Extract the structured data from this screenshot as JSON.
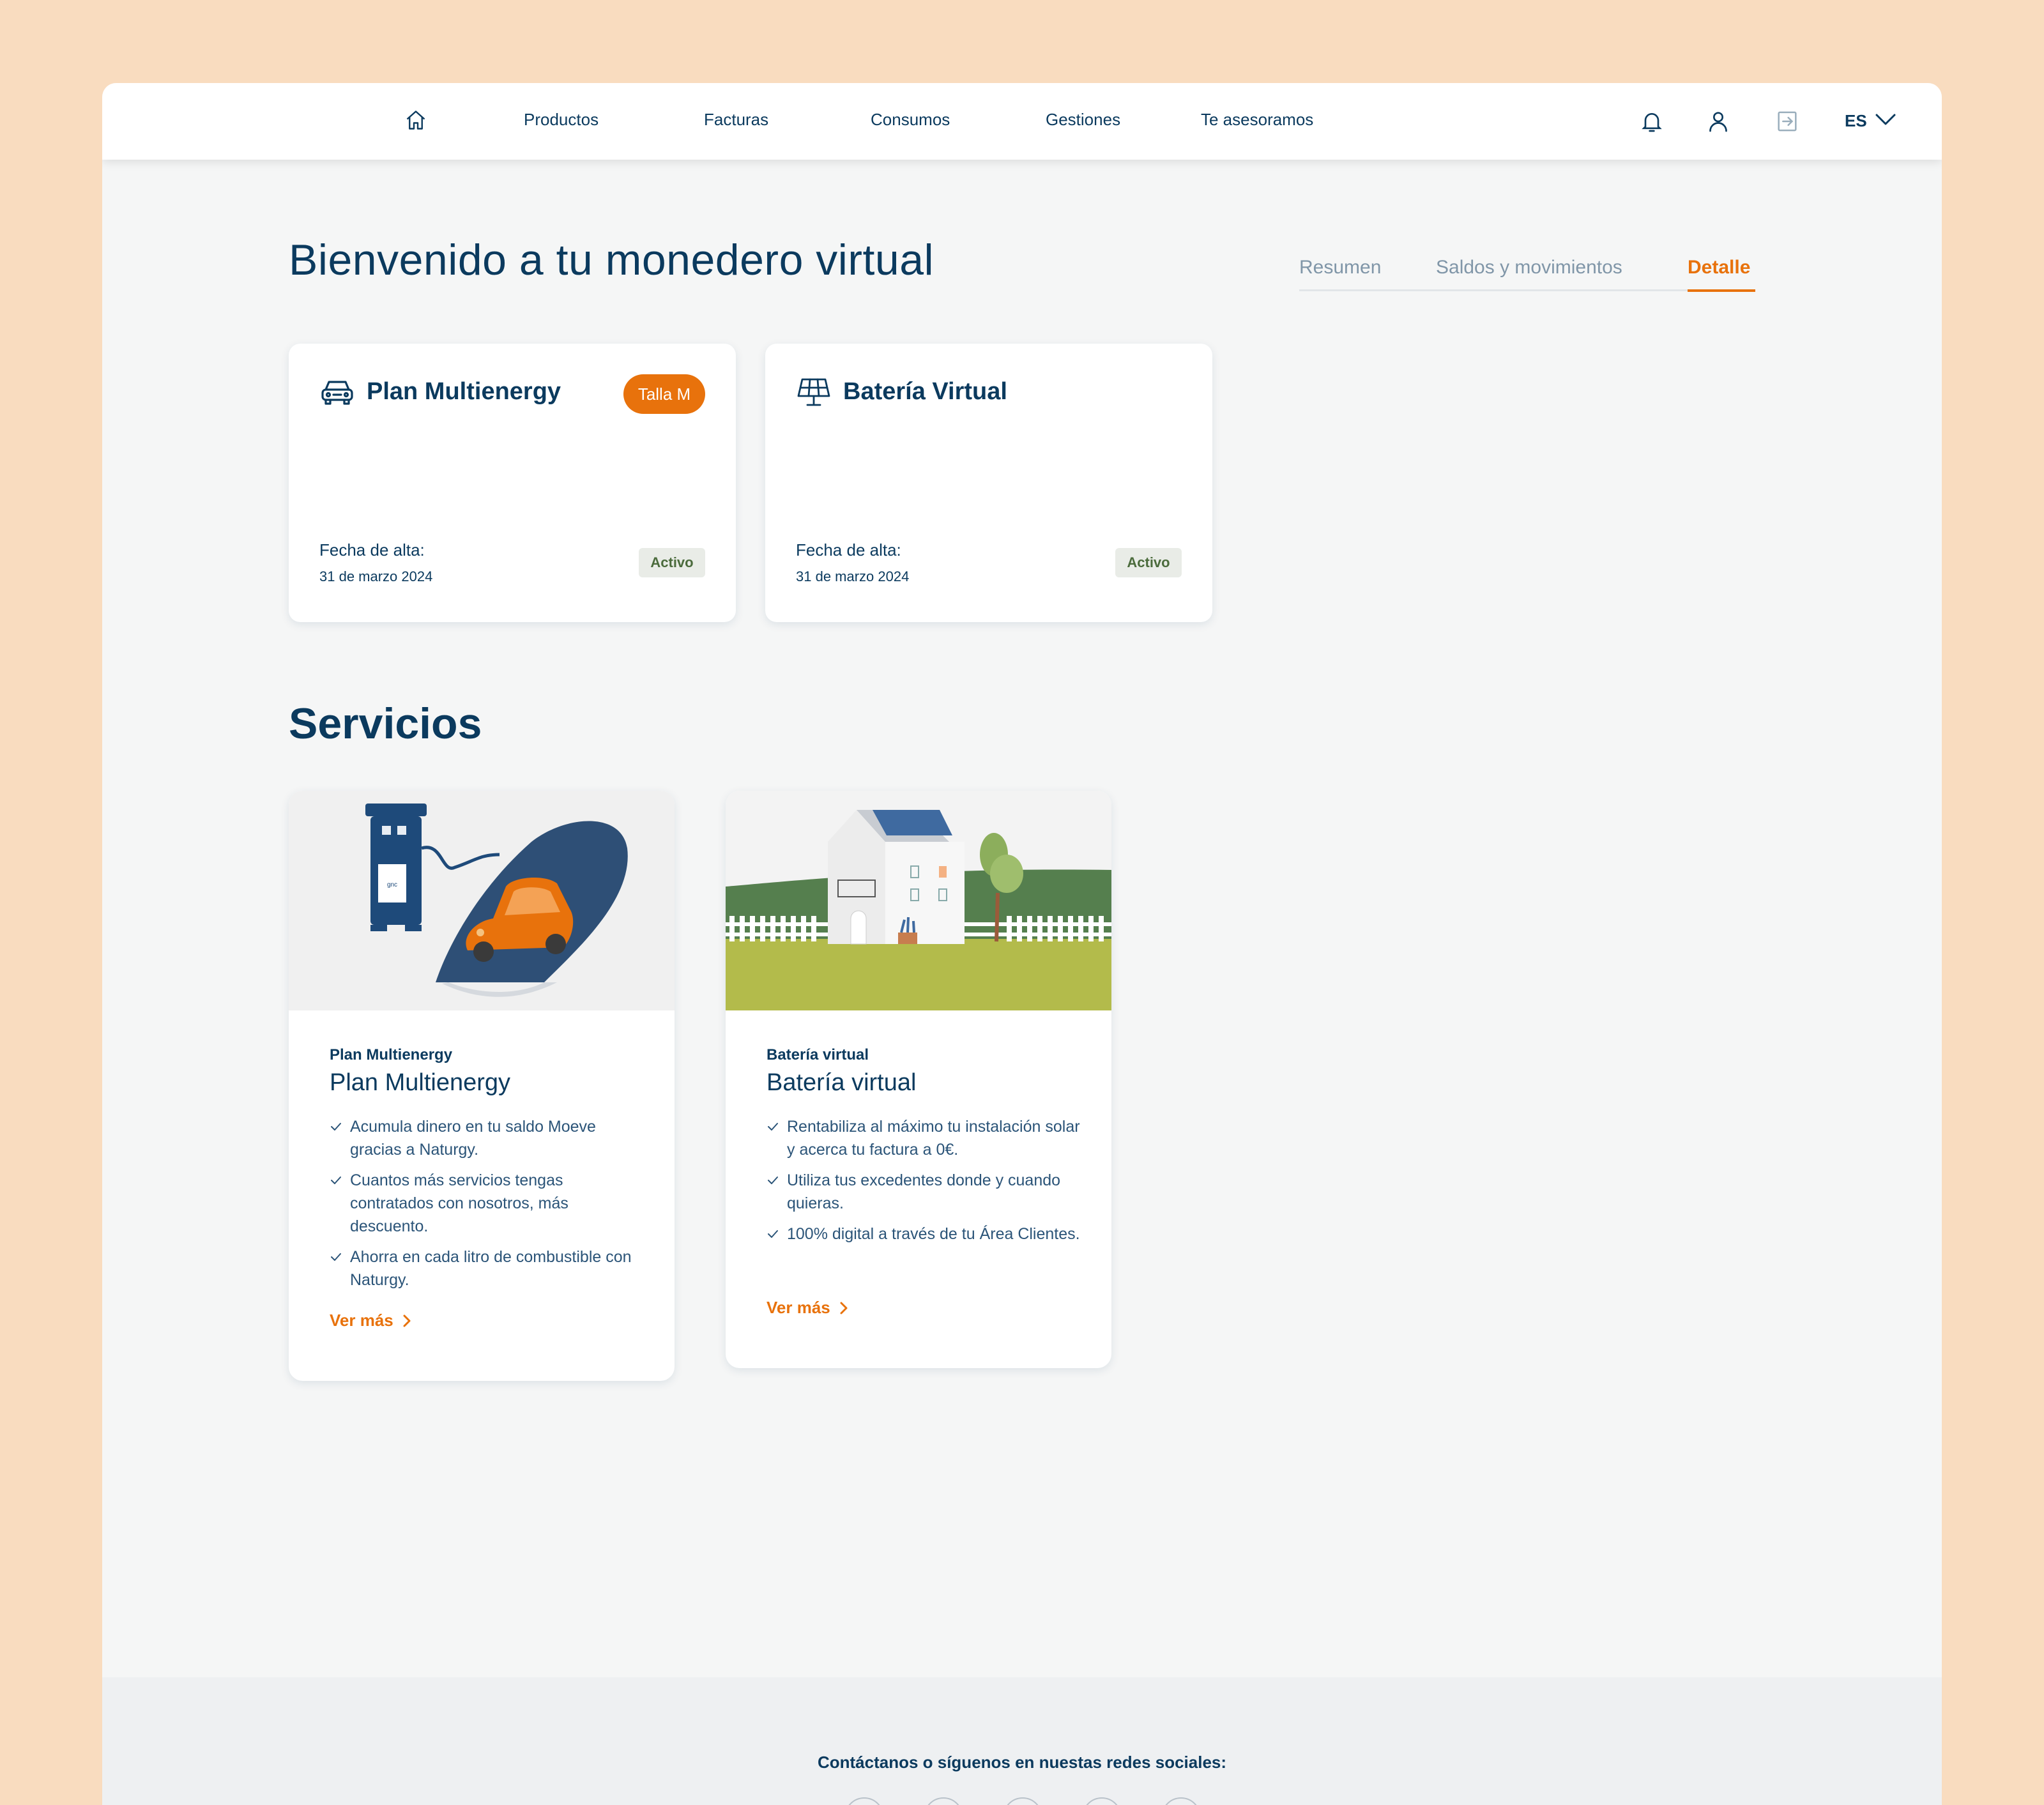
{
  "nav": {
    "items": [
      "Productos",
      "Facturas",
      "Consumos",
      "Gestiones",
      "Te asesoramos"
    ],
    "lang": "ES"
  },
  "page": {
    "title": "Bienvenido a tu monedero virtual",
    "tabs": [
      {
        "label": "Resumen",
        "active": false
      },
      {
        "label": "Saldos y movimientos",
        "active": false
      },
      {
        "label": "Detalle",
        "active": true
      }
    ]
  },
  "products": [
    {
      "title": "Plan Multienergy",
      "badge": "Talla M",
      "icon": "car-icon",
      "fecha_label": "Fecha de alta:",
      "fecha": "31 de marzo 2024",
      "status": "Activo"
    },
    {
      "title": "Batería Virtual",
      "badge": "",
      "icon": "solar-panel-icon",
      "fecha_label": "Fecha de alta:",
      "fecha": "31 de marzo 2024",
      "status": "Activo"
    }
  ],
  "services_title": "Servicios",
  "services": [
    {
      "eyebrow": "Plan Multienergy",
      "title": "Plan Multienergy",
      "bullets": [
        "Acumula dinero en tu saldo Moeve gracias a Naturgy.",
        "Cuantos más servicios tengas contratados con nosotros, más descuento.",
        "Ahorra en cada litro de combustible con Naturgy."
      ],
      "link": "Ver más"
    },
    {
      "eyebrow": "Batería virtual",
      "title": "Batería virtual",
      "bullets": [
        "Rentabiliza al máximo tu instalación solar y acerca tu factura a 0€.",
        "Utiliza tus excedentes donde y cuando quieras.",
        "100% digital a través de tu Área Clientes."
      ],
      "link": "Ver más"
    }
  ],
  "footer": {
    "text": "Contáctanos o síguenos en nuestas redes sociales:"
  },
  "colors": {
    "accent": "#e8720c",
    "primary": "#0b3a5e",
    "background": "#f9dcbf"
  }
}
